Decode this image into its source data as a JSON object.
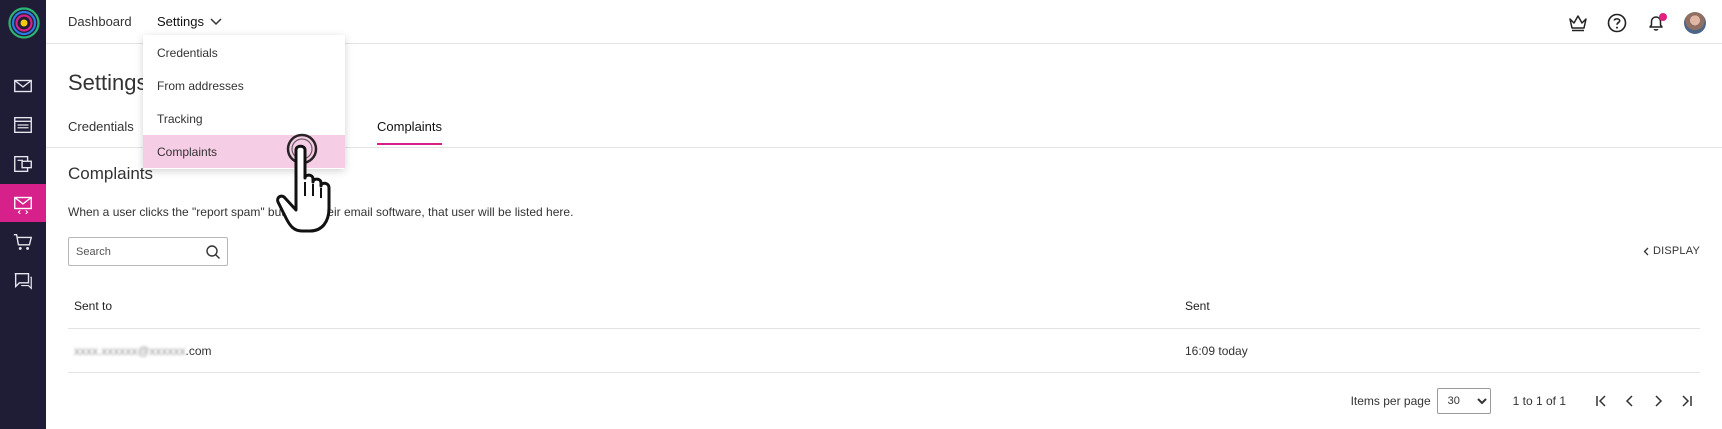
{
  "sidebar": {
    "items": [
      {
        "name": "messages",
        "icon": "envelope-icon",
        "active": false
      },
      {
        "name": "newsletters",
        "icon": "document-icon",
        "active": false
      },
      {
        "name": "forms",
        "icon": "form-icon",
        "active": false
      },
      {
        "name": "transactional",
        "icon": "envelope-code-icon",
        "active": true
      },
      {
        "name": "ecommerce",
        "icon": "cart-icon",
        "active": false
      },
      {
        "name": "chat",
        "icon": "chat-icon",
        "active": false
      }
    ]
  },
  "topbar": {
    "dashboard_label": "Dashboard",
    "settings_label": "Settings"
  },
  "settings_menu": {
    "items": [
      "Credentials",
      "From addresses",
      "Tracking",
      "Complaints"
    ],
    "hovered": "Complaints"
  },
  "page": {
    "title": "Settings",
    "tabs": [
      {
        "label": "Credentials",
        "active": false
      },
      {
        "label": "Complaints",
        "active": true
      }
    ]
  },
  "section": {
    "title": "Complaints",
    "description": "When a user clicks the \"report spam\" button in their email software, that user will be listed here."
  },
  "search": {
    "placeholder": "Search",
    "value": ""
  },
  "display_label": "DISPLAY",
  "table": {
    "headers": [
      "Sent to",
      "Sent"
    ],
    "rows": [
      {
        "sent_to_hidden": "xxxx.xxxxxx@xxxxxx",
        "sent_to_suffix": ".com",
        "sent": "16:09 today"
      }
    ]
  },
  "pagination": {
    "items_per_page_label": "Items per page",
    "items_per_page": "30",
    "options": [
      "30"
    ],
    "range": "1 to 1 of 1"
  },
  "colors": {
    "sidebar_bg": "#1f1d35",
    "accent": "#d6218a",
    "menu_hover": "#f5cde4"
  }
}
